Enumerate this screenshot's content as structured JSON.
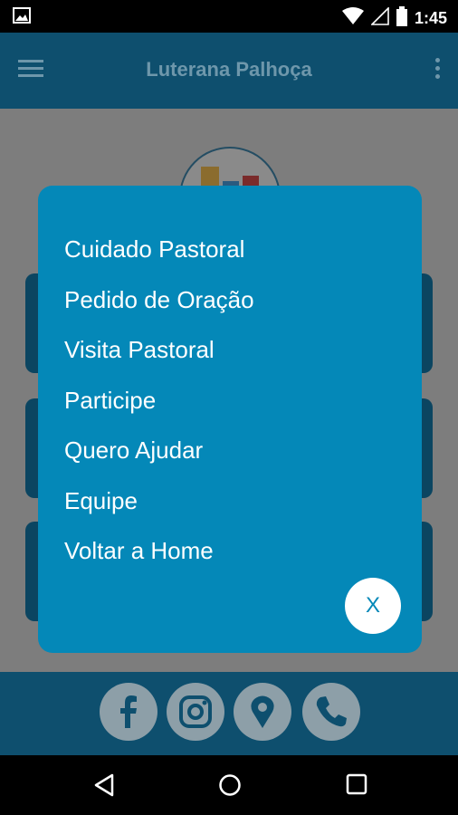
{
  "status_bar": {
    "time": "1:45",
    "icons": [
      "image-icon",
      "wifi-icon",
      "signal-icon",
      "battery-icon"
    ]
  },
  "app_bar": {
    "title": "Luterana Palhoça",
    "icons": [
      "menu-icon",
      "more-vert-icon"
    ]
  },
  "menu": {
    "items": [
      {
        "label": "Cuidado Pastoral"
      },
      {
        "label": "Pedido de Oração"
      },
      {
        "label": "Visita Pastoral"
      },
      {
        "label": "Participe"
      },
      {
        "label": "Quero Ajudar"
      },
      {
        "label": "Equipe"
      },
      {
        "label": "Voltar a Home"
      }
    ],
    "close_label": "X"
  },
  "social": [
    "facebook-icon",
    "instagram-icon",
    "location-icon",
    "phone-icon"
  ],
  "nav": [
    "back-icon",
    "home-icon",
    "recents-icon"
  ],
  "colors": {
    "app_bar": "#0e4f6e",
    "dialog": "#0488b8",
    "overlay": "#7d7d7d"
  }
}
